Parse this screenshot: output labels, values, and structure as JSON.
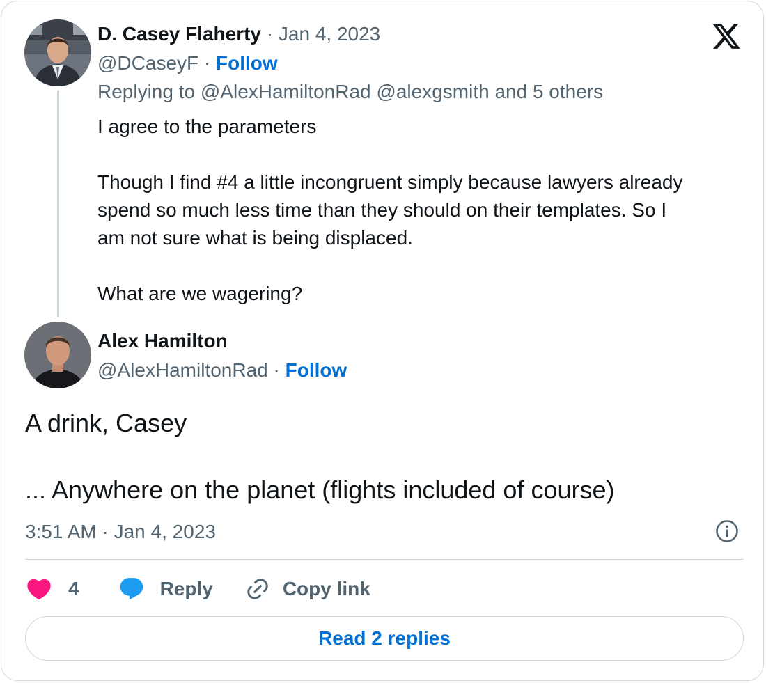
{
  "parent_tweet": {
    "author_name": "D. Casey Flaherty",
    "separator": "·",
    "date": "Jan 4, 2023",
    "handle": "@DCaseyF",
    "follow_label": "Follow",
    "replying_prefix": "Replying to",
    "replying_mention_1": "@AlexHamiltonRad",
    "replying_mention_2": "@alexgsmith",
    "replying_suffix": "and 5 others",
    "text_line_1": "I agree to the parameters",
    "text_line_2": "Though I find #4 a little incongruent simply because lawyers already spend so much less time than they should on their templates. So I am not sure what is being displaced.",
    "text_line_3": "What are we wagering?"
  },
  "main_tweet": {
    "author_name": "Alex Hamilton",
    "handle": "@AlexHamiltonRad",
    "separator": "·",
    "follow_label": "Follow",
    "text_line_1": "A drink, Casey",
    "text_line_2": "... Anywhere on the planet (flights included of course)",
    "timestamp": "3:51 AM · Jan 4, 2023"
  },
  "actions": {
    "like_count": "4",
    "reply_label": "Reply",
    "copy_link_label": "Copy link"
  },
  "read_replies_label": "Read 2 replies",
  "icons": {
    "logo": "x-logo-icon",
    "info": "info-icon",
    "like": "heart-icon",
    "reply": "speech-bubble-icon",
    "copy": "link-icon"
  },
  "colors": {
    "link_blue": "#006fd6",
    "heart_pink": "#f91880",
    "reply_blue": "#1d9bf0",
    "muted_gray": "#536471",
    "border_gray": "#cfd9de"
  }
}
